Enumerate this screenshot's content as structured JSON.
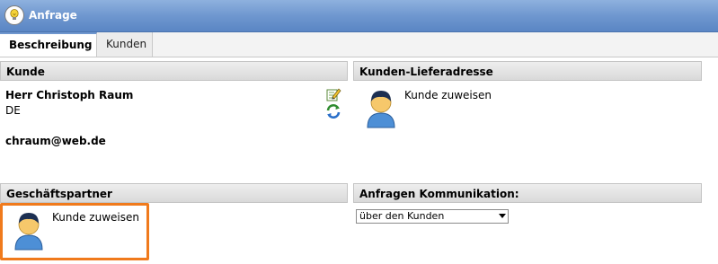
{
  "window": {
    "title": "Anfrage",
    "icon": "lightbulb-icon"
  },
  "tabs": [
    {
      "label": "Beschreibung",
      "active": true
    },
    {
      "label": "Kunden",
      "active": false
    }
  ],
  "sections": {
    "kunde": {
      "header": "Kunde",
      "name": "Herr Christoph Raum",
      "country": "DE",
      "email": "chraum@web.de",
      "icons": [
        "edit-icon",
        "refresh-icon"
      ]
    },
    "lieferadresse": {
      "header": "Kunden-Lieferadresse",
      "assign_label": "Kunde zuweisen",
      "icon": "person-icon"
    },
    "geschaeftspartner": {
      "header": "Geschäftspartner",
      "assign_label": "Kunde zuweisen",
      "icon": "person-icon",
      "highlight_color": "#f07a1c"
    },
    "kommunikation": {
      "header": "Anfragen Kommunikation:",
      "selected": "über den Kunden"
    }
  }
}
